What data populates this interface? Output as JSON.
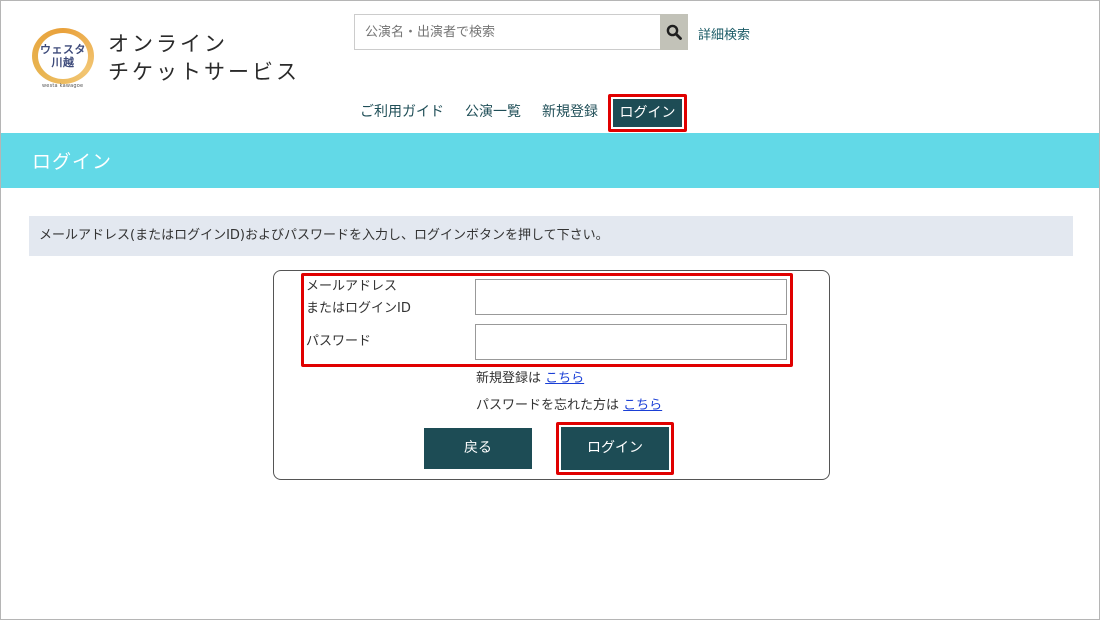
{
  "logo": {
    "line1": "ウェスタ",
    "line2": "川越",
    "sub": "westa kawagoe"
  },
  "site_title": {
    "line1": "オンライン",
    "line2": "チケットサービス"
  },
  "search": {
    "placeholder": "公演名・出演者で検索",
    "icon": "search-icon",
    "advanced_label": "詳細検索"
  },
  "nav": {
    "items": [
      {
        "label": "ご利用ガイド"
      },
      {
        "label": "公演一覧"
      },
      {
        "label": "新規登録"
      },
      {
        "label": "ログイン"
      }
    ]
  },
  "banner": {
    "title": "ログイン"
  },
  "notice": {
    "text": "メールアドレス(またはログインID)およびパスワードを入力し、ログインボタンを押して下さい。"
  },
  "form": {
    "email_label_line1": "メールアドレス",
    "email_label_line2": "またはログインID",
    "password_label": "パスワード",
    "email_value": "",
    "password_value": "",
    "register_prefix": "新規登録は",
    "register_link": "こちら",
    "forgot_prefix": "パスワードを忘れた方は",
    "forgot_link": "こちら",
    "back_button": "戻る",
    "login_button": "ログイン"
  },
  "colors": {
    "accent_dark": "#1d4c55",
    "banner": "#62d9e7",
    "highlight": "#e00000",
    "link": "#1a3fd6"
  }
}
